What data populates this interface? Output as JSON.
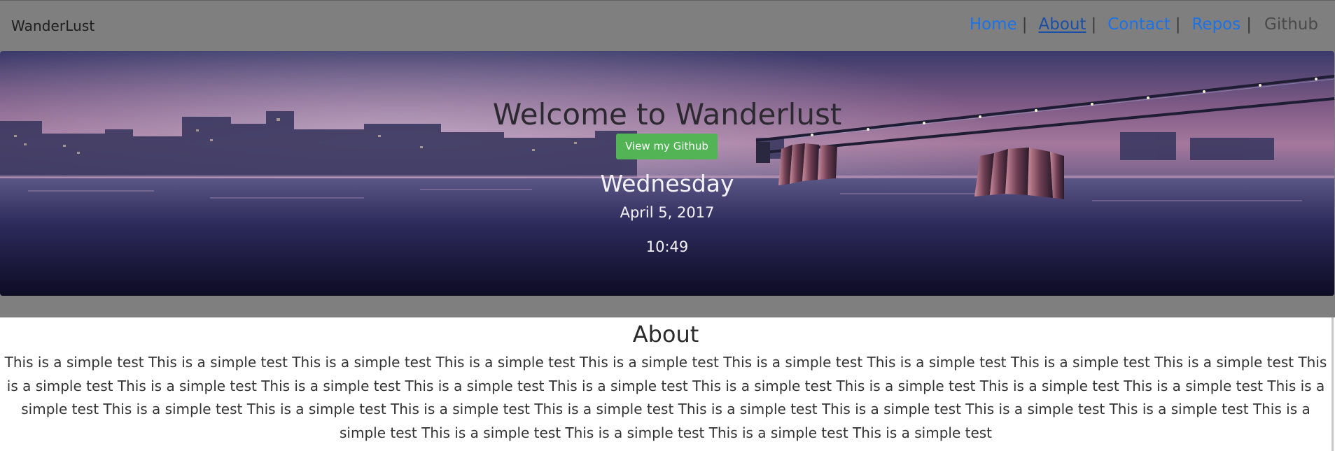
{
  "navbar": {
    "brand": "WanderLust",
    "links": [
      {
        "label": "Home",
        "sep": "|"
      },
      {
        "label": "About",
        "sep": "|"
      },
      {
        "label": "Contact",
        "sep": "|"
      },
      {
        "label": "Repos",
        "sep": "|"
      },
      {
        "label": "Github",
        "sep": ""
      }
    ]
  },
  "hero": {
    "title": "Welcome to Wanderlust",
    "button_label": "View my Github",
    "day": "Wednesday",
    "date": "April 5, 2017",
    "time": "10:49"
  },
  "about": {
    "title": "About",
    "body": "This is a simple test This is a simple test This is a simple test This is a simple test This is a simple test This is a simple test This is a simple test This is a simple test This is a simple test This is a simple test This is a simple test This is a simple test This is a simple test This is a simple test This is a simple test This is a simple test This is a simple test This is a simple test This is a simple test This is a simple test This is a simple test This is a simple test This is a simple test This is a simple test This is a simple test This is a simple test This is a simple test This is a simple test This is a simple test This is a simple test This is a simple test This is a simple test"
  },
  "colors": {
    "nav_link": "#1a73e8",
    "page_band": "#7f7f7f",
    "button_bg": "#53b455"
  }
}
